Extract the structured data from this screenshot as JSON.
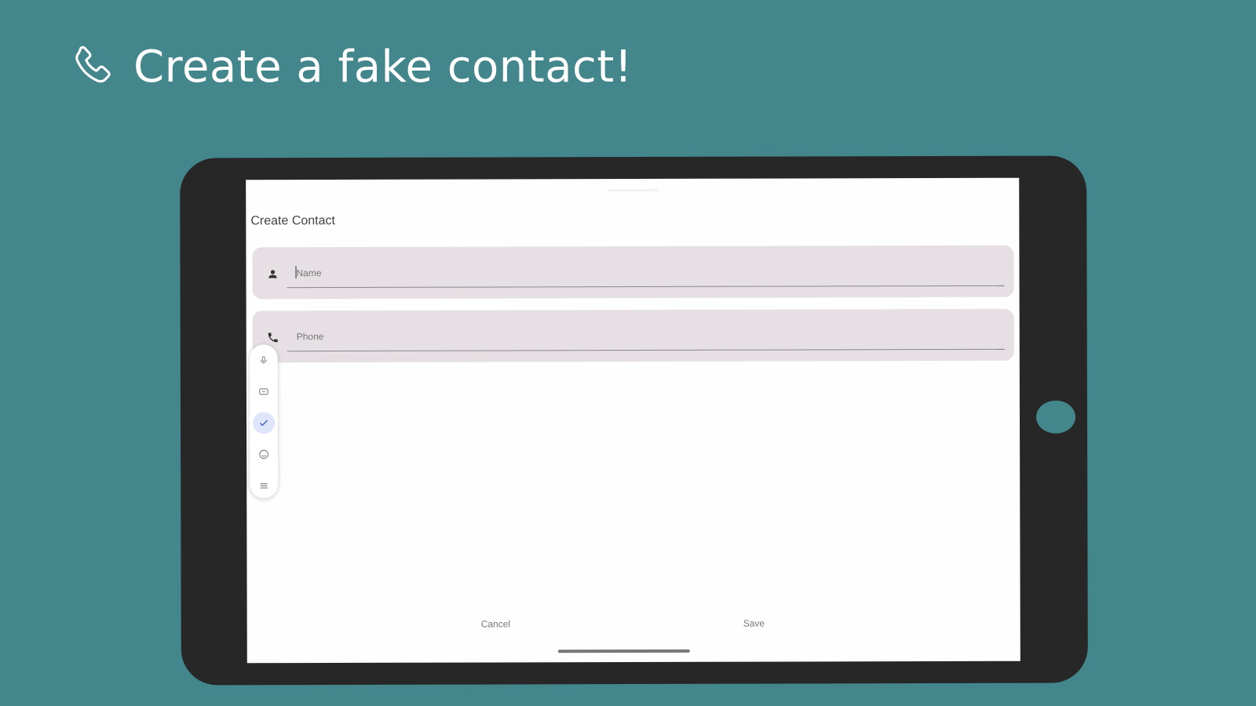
{
  "hero": {
    "title": "Create a fake contact!",
    "icon": "phone-icon"
  },
  "dialog": {
    "title": "Create Contact",
    "fields": {
      "name": {
        "placeholder": "Name",
        "icon": "person-icon"
      },
      "phone": {
        "placeholder": "Phone",
        "icon": "phone-icon"
      }
    },
    "actions": {
      "cancel_label": "Cancel",
      "save_label": "Save"
    }
  },
  "floating_toolbar": {
    "items": [
      "microphone-icon",
      "keyboard-icon",
      "check-icon",
      "emoji-icon",
      "menu-icon"
    ]
  },
  "colors": {
    "background": "#43868c",
    "tablet_frame": "#272727",
    "field_fill": "#e6e0e4",
    "active_chip": "#dfe6fb"
  }
}
